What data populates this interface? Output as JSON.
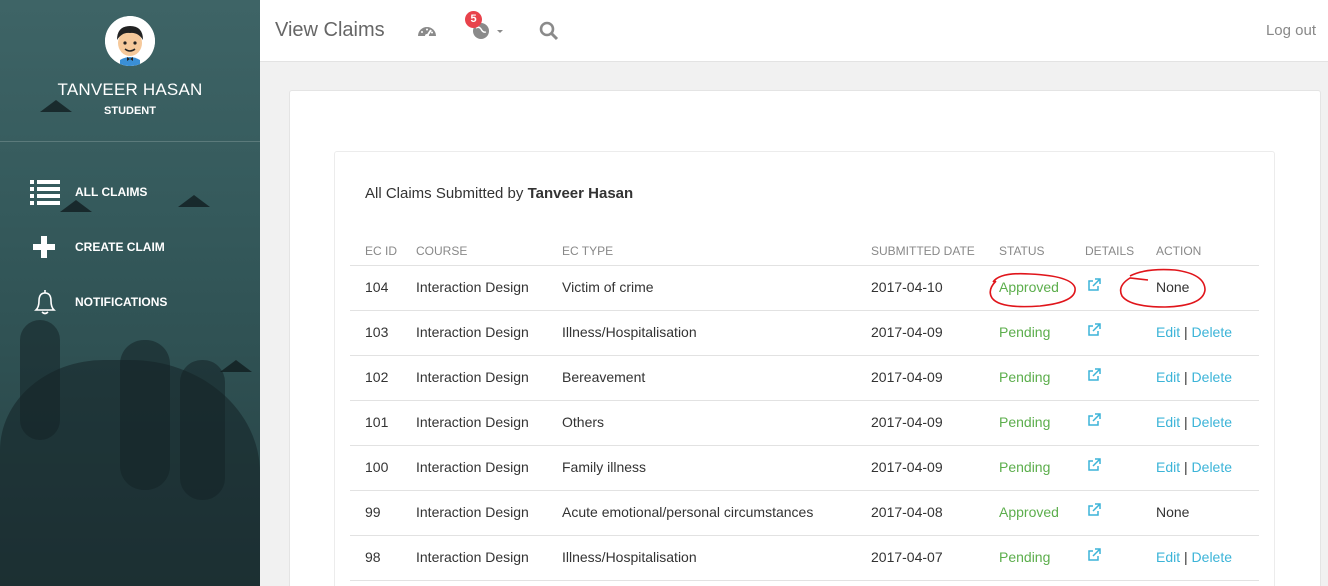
{
  "user": {
    "name": "TANVEER HASAN",
    "role": "STUDENT"
  },
  "sidebar": {
    "items": [
      {
        "label": "ALL CLAIMS",
        "icon": "list-icon"
      },
      {
        "label": "CREATE CLAIM",
        "icon": "plus-icon"
      },
      {
        "label": "NOTIFICATIONS",
        "icon": "bell-icon"
      }
    ]
  },
  "header": {
    "title": "View Claims",
    "notification_count": "5",
    "logout_label": "Log out"
  },
  "main": {
    "heading_prefix": "All Claims Submitted by ",
    "heading_name": "Tanveer Hasan",
    "columns": [
      "EC ID",
      "COURSE",
      "EC TYPE",
      "SUBMITTED DATE",
      "STATUS",
      "DETAILS",
      "ACTION"
    ],
    "rows": [
      {
        "id": "104",
        "course": "Interaction Design",
        "type": "Victim of crime",
        "date": "2017-04-10",
        "status": "Approved",
        "action": "None"
      },
      {
        "id": "103",
        "course": "Interaction Design",
        "type": "Illness/Hospitalisation",
        "date": "2017-04-09",
        "status": "Pending",
        "edit": "Edit",
        "sep": "|",
        "delete": "Delete"
      },
      {
        "id": "102",
        "course": "Interaction Design",
        "type": "Bereavement",
        "date": "2017-04-09",
        "status": "Pending",
        "edit": "Edit",
        "sep": "|",
        "delete": "Delete"
      },
      {
        "id": "101",
        "course": "Interaction Design",
        "type": "Others",
        "date": "2017-04-09",
        "status": "Pending",
        "edit": "Edit",
        "sep": "|",
        "delete": "Delete"
      },
      {
        "id": "100",
        "course": "Interaction Design",
        "type": "Family illness",
        "date": "2017-04-09",
        "status": "Pending",
        "edit": "Edit",
        "sep": "|",
        "delete": "Delete"
      },
      {
        "id": "99",
        "course": "Interaction Design",
        "type": "Acute emotional/personal circumstances",
        "date": "2017-04-08",
        "status": "Approved",
        "action": "None"
      },
      {
        "id": "98",
        "course": "Interaction Design",
        "type": "Illness/Hospitalisation",
        "date": "2017-04-07",
        "status": "Pending",
        "edit": "Edit",
        "sep": "|",
        "delete": "Delete"
      }
    ]
  },
  "colors": {
    "sidebar": "#355a5c",
    "status_green": "#5cae4c",
    "link": "#3cb4d8",
    "badge": "#e8424b",
    "annotation": "#e0151b"
  }
}
